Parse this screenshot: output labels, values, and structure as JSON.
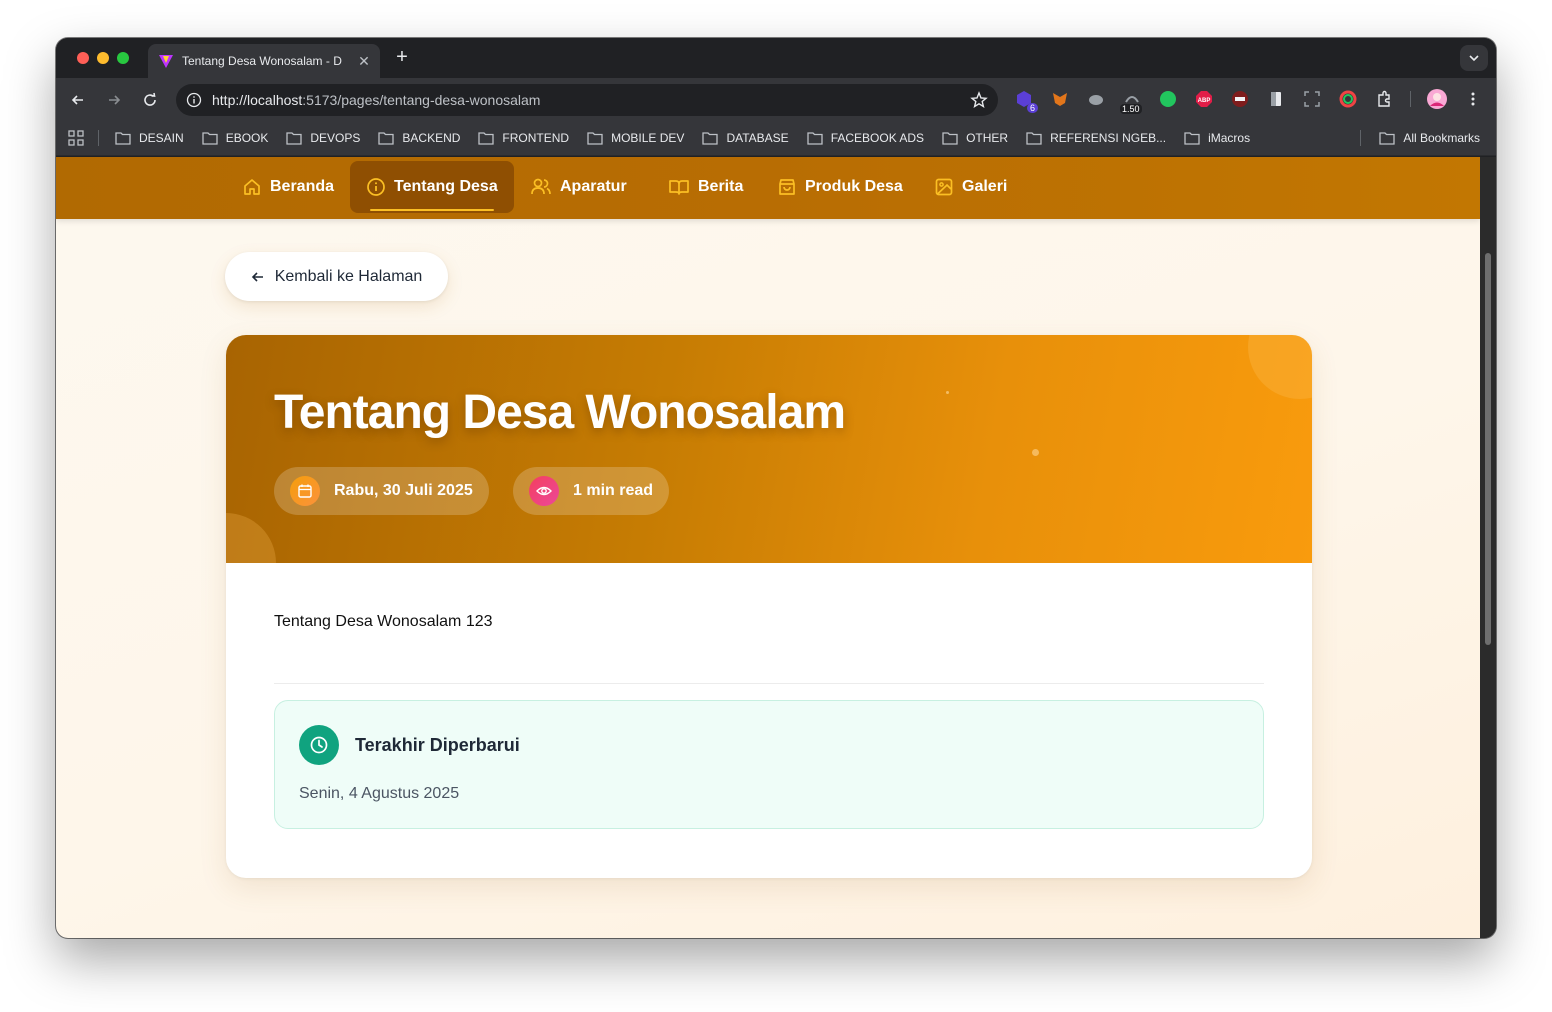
{
  "browser": {
    "tab_title": "Tentang Desa Wonosalam - D",
    "url_host": "http://localhost",
    "url_rest": ":5173/pages/tentang-desa-wonosalam",
    "extension_badges": {
      "ext1": "6",
      "ext4": "1.50"
    },
    "bookmarks": [
      "DESAIN",
      "EBOOK",
      "DEVOPS",
      "BACKEND",
      "FRONTEND",
      "MOBILE DEV",
      "DATABASE",
      "FACEBOOK ADS",
      "OTHER",
      "REFERENSI NGEB...",
      "iMacros"
    ],
    "all_bookmarks": "All Bookmarks"
  },
  "nav": {
    "items": [
      {
        "label": "Beranda",
        "icon": "home-icon"
      },
      {
        "label": "Tentang Desa",
        "icon": "info-icon",
        "active": true
      },
      {
        "label": "Aparatur",
        "icon": "users-icon"
      },
      {
        "label": "Berita",
        "icon": "book-open-icon"
      },
      {
        "label": "Produk Desa",
        "icon": "shopping-bag-icon"
      },
      {
        "label": "Galeri",
        "icon": "image-icon"
      }
    ]
  },
  "back_button": {
    "label": "Kembali ke Halaman"
  },
  "article": {
    "title": "Tentang Desa Wonosalam",
    "date": "Rabu, 30 Juli 2025",
    "read_time": "1 min read",
    "body": "Tentang Desa Wonosalam 123",
    "last_updated": {
      "title": "Terakhir Diperbarui",
      "date": "Senin, 4 Agustus 2025"
    }
  },
  "colors": {
    "nav_bg": "#b86d03",
    "nav_active": "#8f4f02",
    "accent": "#f59e0b",
    "update_bg": "#effdf8",
    "update_icon": "#10a37f"
  }
}
